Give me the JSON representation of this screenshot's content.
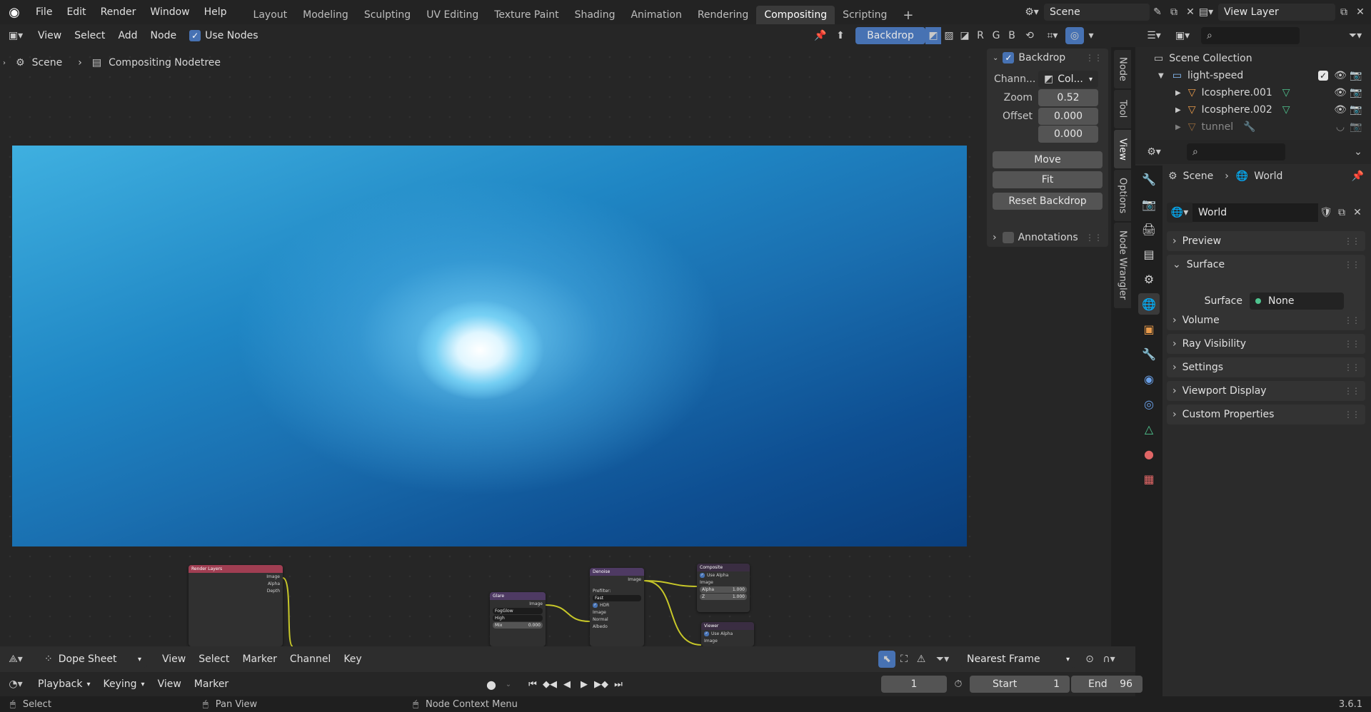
{
  "app": {
    "version": "3.6.1"
  },
  "menu": [
    "File",
    "Edit",
    "Render",
    "Window",
    "Help"
  ],
  "workspaces": {
    "tabs": [
      "Layout",
      "Modeling",
      "Sculpting",
      "UV Editing",
      "Texture Paint",
      "Shading",
      "Animation",
      "Rendering",
      "Compositing",
      "Scripting"
    ],
    "active": "Compositing"
  },
  "topright": {
    "scene": "Scene",
    "view_layer": "View Layer"
  },
  "node_header": {
    "view": "View",
    "select": "Select",
    "add": "Add",
    "node": "Node",
    "use_nodes": "Use Nodes",
    "backdrop": "Backdrop",
    "r": "R",
    "g": "G",
    "b": "B"
  },
  "breadcrumb": {
    "scene": "Scene",
    "tree": "Compositing Nodetree"
  },
  "nodes": {
    "render_layers": {
      "title": "Render Layers",
      "out1": "Image",
      "out2": "Alpha",
      "out3": "Depth"
    },
    "glare": {
      "title": "Glare",
      "out1": "Image",
      "type": "FogGlow",
      "quality": "High",
      "mix_label": "Mix",
      "mix_value": "0.000"
    },
    "denoise": {
      "title": "Denoise",
      "out1": "Image",
      "prefilter_label": "Prefilter:",
      "prefilter": "Fast",
      "hdr": "HDR",
      "in1": "Image",
      "in2": "Normal",
      "in3": "Albedo"
    },
    "composite": {
      "title": "Composite",
      "use_alpha": "Use Alpha",
      "in1": "Image",
      "alpha_label": "Alpha",
      "alpha_value": "1.000",
      "z_label": "Z",
      "z_value": "1.000"
    },
    "viewer": {
      "title": "Viewer",
      "use_alpha": "Use Alpha",
      "in1": "Image"
    }
  },
  "npanel": {
    "backdrop_title": "Backdrop",
    "channels_label": "Chann...",
    "channels_value": "Col...",
    "zoom_label": "Zoom",
    "zoom_value": "0.52",
    "offset_label": "Offset",
    "offset_x": "0.000",
    "offset_y": "0.000",
    "move": "Move",
    "fit": "Fit",
    "reset": "Reset Backdrop",
    "annotations": "Annotations"
  },
  "side_tabs": [
    "Node",
    "Tool",
    "View",
    "Options",
    "Node Wrangler"
  ],
  "outliner": {
    "root": "Scene Collection",
    "collection": "light-speed",
    "items": [
      "Icosphere.001",
      "Icosphere.002",
      "tunnel"
    ]
  },
  "properties": {
    "breadcrumb_scene": "Scene",
    "breadcrumb_world": "World",
    "world_name": "World",
    "sections": [
      "Preview",
      "Surface",
      "Volume",
      "Ray Visibility",
      "Settings",
      "Viewport Display",
      "Custom Properties"
    ],
    "surface_label": "Surface",
    "surface_value": "None"
  },
  "dopesheet": {
    "mode": "Dope Sheet",
    "view": "View",
    "select": "Select",
    "marker": "Marker",
    "channel": "Channel",
    "key": "Key",
    "snap": "Nearest Frame"
  },
  "timeline": {
    "playback": "Playback",
    "keying": "Keying",
    "view": "View",
    "marker": "Marker",
    "current_frame": "1",
    "start_label": "Start",
    "start": "1",
    "end_label": "End",
    "end": "96"
  },
  "status": {
    "select": "Select",
    "pan": "Pan View",
    "context": "Node Context Menu"
  },
  "colors": {
    "accent": "#4772b3",
    "active_tab": "#3a3a3a",
    "socket": "#c7c729"
  }
}
